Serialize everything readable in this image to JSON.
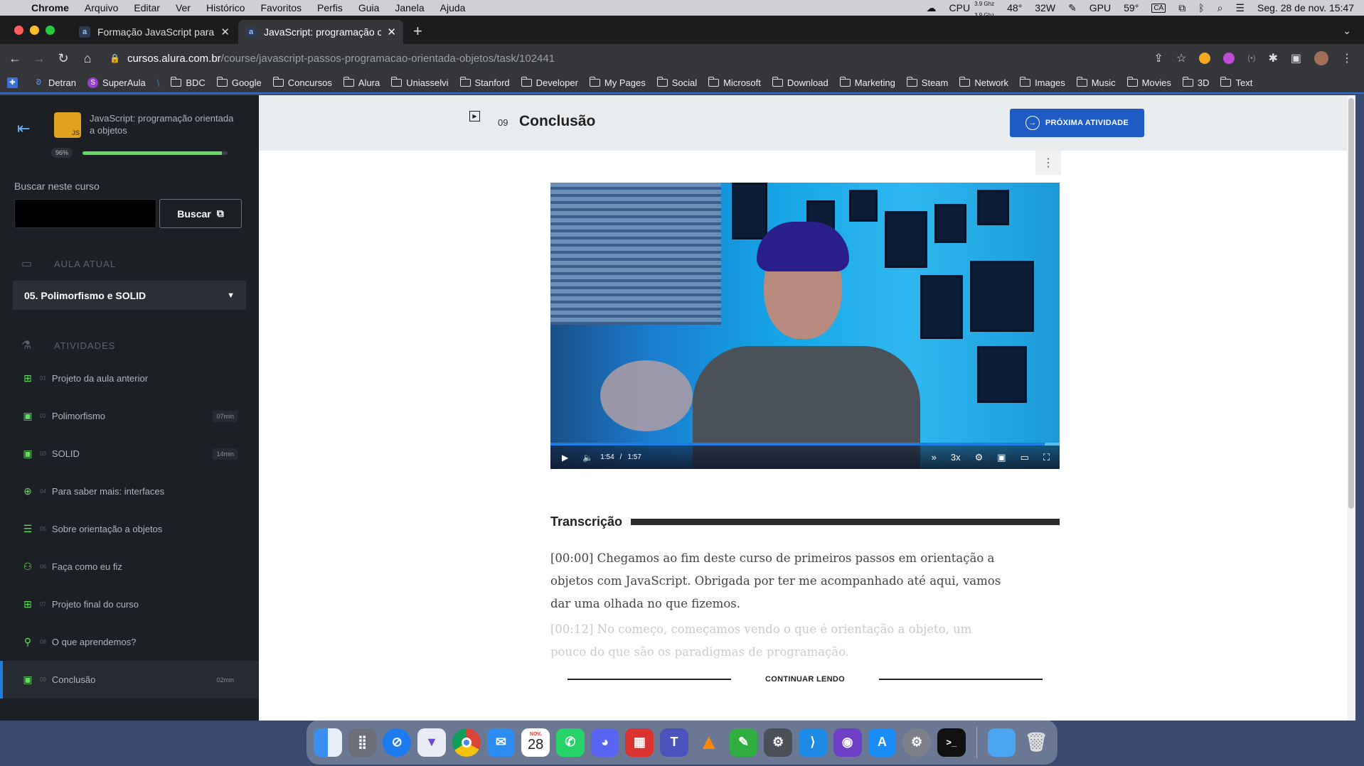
{
  "menubar": {
    "apple": "",
    "items": [
      "Chrome",
      "Arquivo",
      "Editar",
      "Ver",
      "Histórico",
      "Favoritos",
      "Perfis",
      "Guia",
      "Janela",
      "Ajuda"
    ],
    "cpu_label": "CPU",
    "cpu_ghz_1": "3.9 Ghz",
    "cpu_ghz_2": "3.9 Ghz",
    "temp1": "48°",
    "watts": "32W",
    "gpu_label": "GPU",
    "temp2": "59°",
    "input_source": "CA",
    "datetime": "Seg. 28 de nov.  15:47"
  },
  "tabs": [
    {
      "title": "Formação JavaScript para back-end",
      "favicon": "a"
    },
    {
      "title": "JavaScript: programação orientada a objetos",
      "favicon": "a"
    }
  ],
  "address": {
    "host": "cursos.alura.com.br",
    "path": "/course/javascript-passos-programacao-orientada-objetos/task/102441"
  },
  "bookmarks": [
    "Detran",
    "SuperAula",
    "BDC",
    "Google",
    "Concursos",
    "Alura",
    "Uniasselvi",
    "Stanford",
    "Developer",
    "My Pages",
    "Social",
    "Microsoft",
    "Download",
    "Marketing",
    "Steam",
    "Network",
    "Images",
    "Music",
    "Movies",
    "3D",
    "Text"
  ],
  "sidebar": {
    "course_title": "JavaScript: programação orientada a objetos",
    "progress_label": "96%",
    "progress": 0.96,
    "search_label": "Buscar neste curso",
    "search_button": "Buscar",
    "current_section": "AULA ATUAL",
    "current_lesson": "05. Polimorfismo e SOLID",
    "activities_section": "ATIVIDADES",
    "activities": [
      {
        "num": "01",
        "label": "Projeto da aula anterior",
        "duration": "",
        "icon": "book-icon"
      },
      {
        "num": "02",
        "label": "Polimorfismo",
        "duration": "07min",
        "icon": "video-icon"
      },
      {
        "num": "03",
        "label": "SOLID",
        "duration": "14min",
        "icon": "video-icon"
      },
      {
        "num": "04",
        "label": "Para saber mais: interfaces",
        "duration": "",
        "icon": "plus-circle-icon"
      },
      {
        "num": "05",
        "label": "Sobre orientação a objetos",
        "duration": "",
        "icon": "list-icon"
      },
      {
        "num": "06",
        "label": "Faça como eu fiz",
        "duration": "",
        "icon": "people-icon"
      },
      {
        "num": "07",
        "label": "Projeto final do curso",
        "duration": "",
        "icon": "book-icon"
      },
      {
        "num": "08",
        "label": "O que aprendemos?",
        "duration": "",
        "icon": "person-check-icon"
      },
      {
        "num": "09",
        "label": "Conclusão",
        "duration": "02min",
        "icon": "video-icon"
      }
    ]
  },
  "main": {
    "task_number": "09",
    "task_title": "Conclusão",
    "next_button": "PRÓXIMA ATIVIDADE",
    "video": {
      "current": "1:54",
      "separator": "/",
      "total": "1:57",
      "speed": "3x",
      "progress": 0.97
    },
    "transcript_title": "Transcrição",
    "paragraph1": "[00:00] Chegamos ao fim deste curso de primeiros passos em orientação a objetos com JavaScript. Obrigada por ter me acompanhado até aqui, vamos dar uma olhada no que fizemos.",
    "paragraph2": "[00:12] No começo, começamos vendo o que é orientação a objeto, um pouco do que são os paradigmas de programação.",
    "continue_label": "CONTINUAR LENDO"
  },
  "dock": {
    "calendar_month": "NOV.",
    "calendar_day": "28"
  },
  "colors": {
    "accent": "#1f5bc4",
    "progress": "#5fdd5e",
    "sidebar_bg": "#1c1f24"
  }
}
